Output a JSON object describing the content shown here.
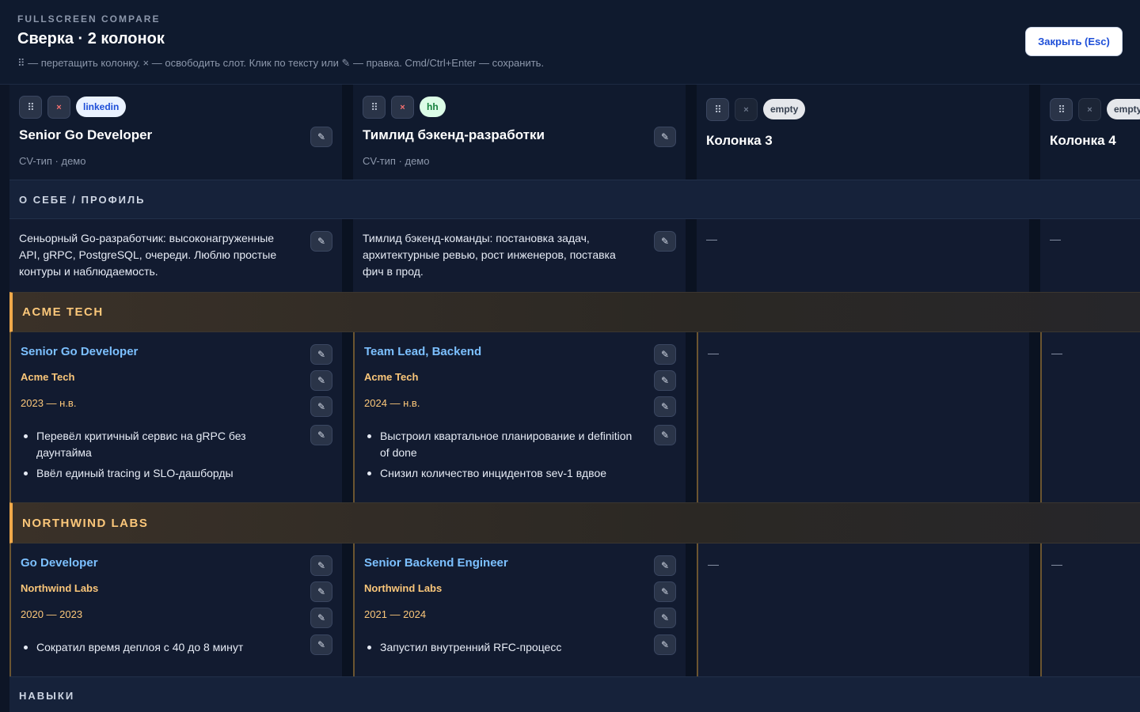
{
  "header": {
    "kicker": "FULLSCREEN COMPARE",
    "title": "Сверка · 2 колонок",
    "hint": "⠿ — перетащить колонку. × — освободить слот. Клик по тексту или ✎ — правка. Cmd/Ctrl+Enter — сохранить.",
    "close_label": "Закрыть (Esc)"
  },
  "icons": {
    "grip": "⠿",
    "remove": "×",
    "edit": "✎"
  },
  "columns": [
    {
      "badge": "linkedin",
      "title": "Senior Go Developer",
      "sub": "CV-тип · демо"
    },
    {
      "badge": "hh",
      "title": "Тимлид бэкенд-разработки",
      "sub": "CV-тип · демо"
    },
    {
      "badge": "empty",
      "title": "Колонка 3"
    },
    {
      "badge": "empty",
      "title": "Колонка 4"
    }
  ],
  "sections": {
    "profile": "О СЕБЕ / ПРОФИЛЬ",
    "skills": "НАВЫКИ"
  },
  "profile": [
    "Сеньорный Go-разработчик: высоконагруженные API, gRPC, PostgreSQL, очереди. Люблю простые контуры и наблюдаемость.",
    "Тимлид бэкенд-команды: постановка задач, архитектурные ревью, рост инженеров, поставка фич в прод.",
    "—",
    "—"
  ],
  "companies": [
    {
      "name": "ACME TECH",
      "entries": [
        {
          "role": "Senior Go Developer",
          "org": "Acme Tech",
          "period": "2023 — н.в.",
          "bullets": [
            "Перевёл критичный сервис на gRPC без даунтайма",
            "Ввёл единый tracing и SLO-дашборды"
          ]
        },
        {
          "role": "Team Lead, Backend",
          "org": "Acme Tech",
          "period": "2024 — н.в.",
          "bullets": [
            "Выстроил квартальное планирование и definition of done",
            "Снизил количество инцидентов sev-1 вдвое"
          ]
        }
      ],
      "empty": "—"
    },
    {
      "name": "NORTHWIND LABS",
      "entries": [
        {
          "role": "Go Developer",
          "org": "Northwind Labs",
          "period": "2020 — 2023",
          "bullets": [
            "Сократил время деплоя с 40 до 8 минут"
          ]
        },
        {
          "role": "Senior Backend Engineer",
          "org": "Northwind Labs",
          "period": "2021 — 2024",
          "bullets": [
            "Запустил внутренний RFC-процесс"
          ]
        }
      ],
      "empty": "—"
    }
  ],
  "colors": {
    "accent": "#f0a94a",
    "link": "#7cc0ff",
    "bg": "#0d1526"
  }
}
